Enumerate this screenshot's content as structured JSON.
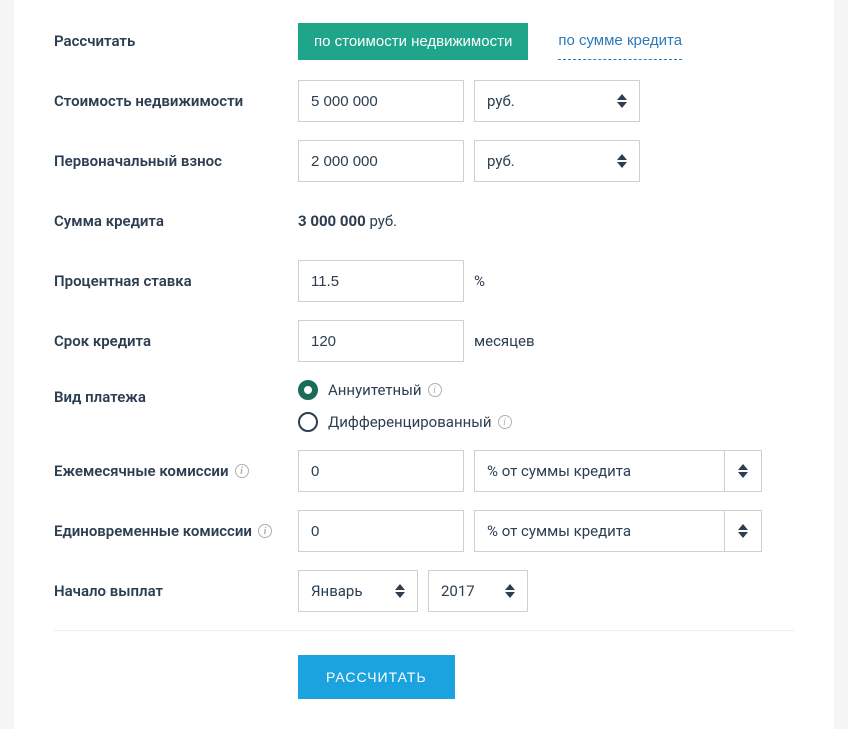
{
  "labels": {
    "calculate_by": "Рассчитать",
    "property_cost": "Стоимость недвижимости",
    "down_payment": "Первоначальный взнос",
    "loan_amount": "Сумма кредита",
    "interest_rate": "Процентная ставка",
    "loan_term": "Срок кредита",
    "payment_type": "Вид платежа",
    "monthly_fees": "Ежемесячные комиссии",
    "one_time_fees": "Единовременные комиссии",
    "start_date": "Начало выплат"
  },
  "tabs": {
    "by_property": "по стоимости недвижимости",
    "by_loan": "по сумме кредита"
  },
  "values": {
    "property_cost": "5 000 000",
    "down_payment": "2 000 000",
    "loan_amount": "3 000 000",
    "interest_rate": "11.5",
    "loan_term": "120",
    "monthly_fees": "0",
    "one_time_fees": "0"
  },
  "units": {
    "currency": "руб.",
    "percent": "%",
    "months": "месяцев",
    "percent_of_loan": "% от суммы кредита"
  },
  "payment_types": {
    "annuity": "Аннуитетный",
    "differentiated": "Дифференцированный"
  },
  "date": {
    "month": "Январь",
    "year": "2017"
  },
  "buttons": {
    "calculate": "РАССЧИТАТЬ"
  }
}
